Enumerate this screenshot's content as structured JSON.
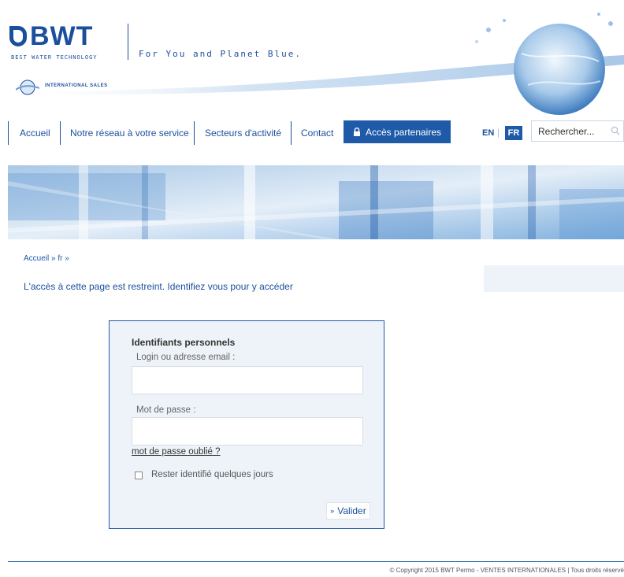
{
  "header": {
    "logo_text": "BWT",
    "logo_subtitle": "BEST WATER TECHNOLOGY",
    "tagline": "For You and Planet Blue.",
    "intl_label": "INTERNATIONAL SALES"
  },
  "nav": {
    "items": [
      "Accueil",
      "Notre réseau à votre service",
      "Secteurs d'activité",
      "Contact"
    ],
    "partners_label": "Accès partenaires",
    "lang_en": "EN",
    "lang_sep": "|",
    "lang_fr": "FR",
    "search_placeholder": "Rechercher..."
  },
  "breadcrumb": {
    "home": "Accueil",
    "sep1": "»",
    "current": "fr",
    "sep2": "»"
  },
  "restricted_message": "L'accès à cette page est restreint. Identifiez vous pour y accéder",
  "login": {
    "title": "Identifiants personnels",
    "login_label": "Login ou adresse email :",
    "login_value": "",
    "password_label": "Mot de passe :",
    "password_value": "",
    "forgot_label": "mot de passe oublié ?",
    "remember_label": "Rester identifié quelques jours",
    "remember_checked": false,
    "submit_arrows": "»",
    "submit_label": "Valider"
  },
  "footer": {
    "copyright": "© Copyright 2015 BWT Permo - VENTES INTERNATIONALES | Tous droits réservé"
  },
  "colors": {
    "brand_blue": "#1a4f9c",
    "button_blue": "#1e5aa8",
    "panel_bg": "#eef3f9"
  }
}
